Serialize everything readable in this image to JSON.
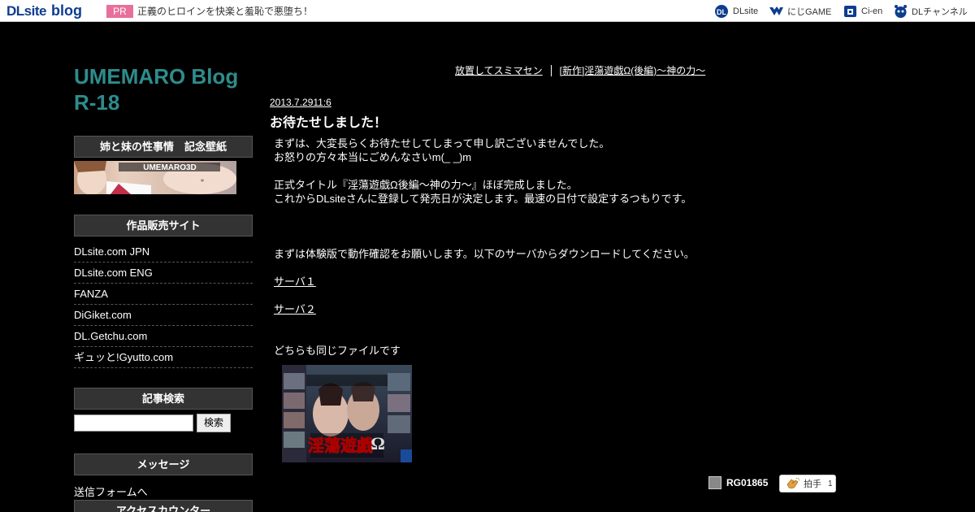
{
  "topbar": {
    "logo_dl": "DL",
    "logo_site": "site",
    "logo_blog": "blog",
    "pr_label": "PR",
    "pr_text": "正義のヒロインを快楽と羞恥で悪堕ち！",
    "links": [
      {
        "label": "DLsite",
        "icon": "dlsite-icon"
      },
      {
        "label": "にじGAME",
        "icon": "nijigame-icon"
      },
      {
        "label": "Ci-en",
        "icon": "cien-icon"
      },
      {
        "label": "DLチャンネル",
        "icon": "dlchannel-icon"
      }
    ]
  },
  "blog": {
    "title_line1": "UMEMARO Blog",
    "title_line2": "R-18"
  },
  "sidebar": {
    "wallpaper_heading": "姉と妹の性事情　記念壁紙",
    "banner_text": "UMEMARO3D",
    "sites_heading": "作品販売サイト",
    "sites": [
      "DLsite.com JPN",
      "DLsite.com ENG",
      "FANZA",
      "DiGiket.com",
      "DL.Getchu.com",
      "ギュッと!Gyutto.com"
    ],
    "search_heading": "記事検索",
    "search_button": "検索",
    "search_value": "",
    "message_heading": "メッセージ",
    "message_link": "送信フォームへ",
    "counter_heading": "アクセスカウンター"
  },
  "nav": {
    "prev": "放置してスミマセン",
    "next": "[新作]淫蕩遊戯Ω(後編)～神の力～"
  },
  "post": {
    "date": "2013.7.2911:6",
    "title": "お待たせしました！",
    "lines": [
      "まずは、大変長らくお待たせしてしまって申し訳ございませんでした。",
      "お怒りの方々本当にごめんなさいm(_ _)m",
      "正式タイトル『淫蕩遊戯Ω後編～神の力～』ほぼ完成しました。",
      "これからDLsiteさんに登録して発売日が決定します。最速の日付で設定するつもりです。",
      "まずは体験版で動作確認をお願いします。以下のサーバからダウンロードしてください。",
      "どちらも同じファイルです"
    ],
    "server1": "サーバ１",
    "server2": "サーバ２",
    "thumb_title": "淫蕩遊戯",
    "author": "RG01865",
    "clap_label": "拍手",
    "clap_count": "1"
  },
  "colors": {
    "background": "#000000",
    "title": "#2e8c8c",
    "pr": "#e86f9b",
    "logo": "#0d3d8f",
    "sidebar_heading_bg": "#333333"
  }
}
